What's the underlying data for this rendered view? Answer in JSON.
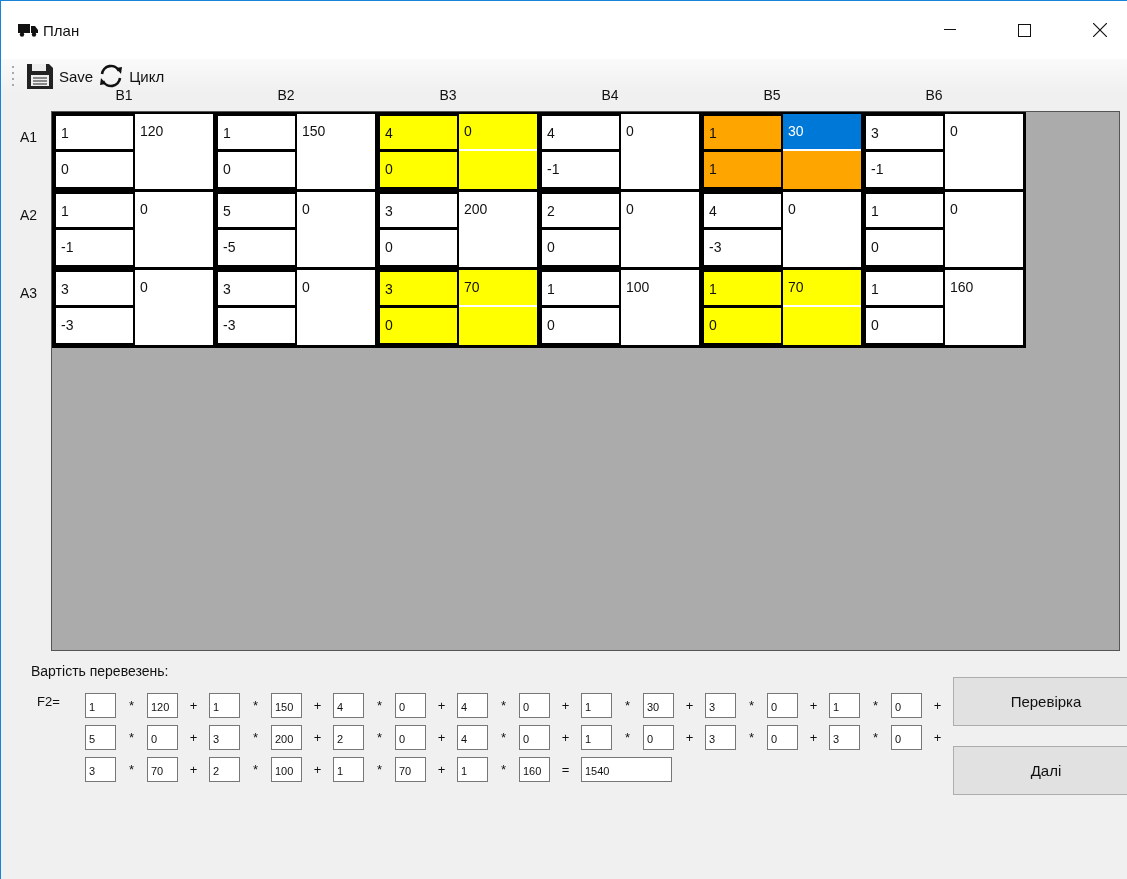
{
  "window": {
    "title": "План"
  },
  "toolbar": [
    {
      "kind": "save",
      "label": "Save"
    },
    {
      "kind": "cycle",
      "label": "Цикл"
    }
  ],
  "plan": {
    "columns": [
      "B1",
      "B2",
      "B3",
      "B4",
      "B5",
      "B6"
    ],
    "rows": [
      {
        "label": "A1",
        "cells": [
          {
            "cost": "1",
            "potential": "0",
            "amount": "120",
            "color": "#ffffff",
            "amount_selected": false
          },
          {
            "cost": "1",
            "potential": "0",
            "amount": "150",
            "color": "#ffffff",
            "amount_selected": false
          },
          {
            "cost": "4",
            "potential": "0",
            "amount": "0",
            "color": "#ffff00",
            "amount_selected": false
          },
          {
            "cost": "4",
            "potential": "-1",
            "amount": "0",
            "color": "#ffffff",
            "amount_selected": false
          },
          {
            "cost": "1",
            "potential": "1",
            "amount": "30",
            "color": "#ffa500",
            "amount_selected": true
          },
          {
            "cost": "3",
            "potential": "-1",
            "amount": "0",
            "color": "#ffffff",
            "amount_selected": false
          }
        ]
      },
      {
        "label": "A2",
        "cells": [
          {
            "cost": "1",
            "potential": "-1",
            "amount": "0",
            "color": "#ffffff",
            "amount_selected": false
          },
          {
            "cost": "5",
            "potential": "-5",
            "amount": "0",
            "color": "#ffffff",
            "amount_selected": false
          },
          {
            "cost": "3",
            "potential": "0",
            "amount": "200",
            "color": "#ffffff",
            "amount_selected": false
          },
          {
            "cost": "2",
            "potential": "0",
            "amount": "0",
            "color": "#ffffff",
            "amount_selected": false
          },
          {
            "cost": "4",
            "potential": "-3",
            "amount": "0",
            "color": "#ffffff",
            "amount_selected": false
          },
          {
            "cost": "1",
            "potential": "0",
            "amount": "0",
            "color": "#ffffff",
            "amount_selected": false
          }
        ]
      },
      {
        "label": "A3",
        "cells": [
          {
            "cost": "3",
            "potential": "-3",
            "amount": "0",
            "color": "#ffffff",
            "amount_selected": false
          },
          {
            "cost": "3",
            "potential": "-3",
            "amount": "0",
            "color": "#ffffff",
            "amount_selected": false
          },
          {
            "cost": "3",
            "potential": "0",
            "amount": "70",
            "color": "#ffff00",
            "amount_selected": false
          },
          {
            "cost": "1",
            "potential": "0",
            "amount": "100",
            "color": "#ffffff",
            "amount_selected": false
          },
          {
            "cost": "1",
            "potential": "0",
            "amount": "70",
            "color": "#ffff00",
            "amount_selected": false
          },
          {
            "cost": "1",
            "potential": "0",
            "amount": "160",
            "color": "#ffffff",
            "amount_selected": false
          }
        ]
      }
    ]
  },
  "cost_section": {
    "title": "Вартість перевезень:",
    "label": "F2=",
    "lines": [
      [
        {
          "kind": "field",
          "text": "1"
        },
        {
          "kind": "op",
          "text": "*"
        },
        {
          "kind": "field",
          "text": "120"
        },
        {
          "kind": "op",
          "text": "+"
        },
        {
          "kind": "field",
          "text": "1"
        },
        {
          "kind": "op",
          "text": "*"
        },
        {
          "kind": "field",
          "text": "150"
        },
        {
          "kind": "op",
          "text": "+"
        },
        {
          "kind": "field",
          "text": "4"
        },
        {
          "kind": "op",
          "text": "*"
        },
        {
          "kind": "field",
          "text": "0"
        },
        {
          "kind": "op",
          "text": "+"
        },
        {
          "kind": "field",
          "text": "4"
        },
        {
          "kind": "op",
          "text": "*"
        },
        {
          "kind": "field",
          "text": "0"
        },
        {
          "kind": "op",
          "text": "+"
        },
        {
          "kind": "field",
          "text": "1"
        },
        {
          "kind": "op",
          "text": "*"
        },
        {
          "kind": "field",
          "text": "30"
        },
        {
          "kind": "op",
          "text": "+"
        },
        {
          "kind": "field",
          "text": "3"
        },
        {
          "kind": "op",
          "text": "*"
        },
        {
          "kind": "field",
          "text": "0"
        },
        {
          "kind": "op",
          "text": "+"
        },
        {
          "kind": "field",
          "text": "1"
        },
        {
          "kind": "op",
          "text": "*"
        },
        {
          "kind": "field",
          "text": "0"
        },
        {
          "kind": "op",
          "text": "+"
        }
      ],
      [
        {
          "kind": "field",
          "text": "5"
        },
        {
          "kind": "op",
          "text": "*"
        },
        {
          "kind": "field",
          "text": "0"
        },
        {
          "kind": "op",
          "text": "+"
        },
        {
          "kind": "field",
          "text": "3"
        },
        {
          "kind": "op",
          "text": "*"
        },
        {
          "kind": "field",
          "text": "200"
        },
        {
          "kind": "op",
          "text": "+"
        },
        {
          "kind": "field",
          "text": "2"
        },
        {
          "kind": "op",
          "text": "*"
        },
        {
          "kind": "field",
          "text": "0"
        },
        {
          "kind": "op",
          "text": "+"
        },
        {
          "kind": "field",
          "text": "4"
        },
        {
          "kind": "op",
          "text": "*"
        },
        {
          "kind": "field",
          "text": "0"
        },
        {
          "kind": "op",
          "text": "+"
        },
        {
          "kind": "field",
          "text": "1"
        },
        {
          "kind": "op",
          "text": "*"
        },
        {
          "kind": "field",
          "text": "0"
        },
        {
          "kind": "op",
          "text": "+"
        },
        {
          "kind": "field",
          "text": "3"
        },
        {
          "kind": "op",
          "text": "*"
        },
        {
          "kind": "field",
          "text": "0"
        },
        {
          "kind": "op",
          "text": "+"
        },
        {
          "kind": "field",
          "text": "3"
        },
        {
          "kind": "op",
          "text": "*"
        },
        {
          "kind": "field",
          "text": "0"
        },
        {
          "kind": "op",
          "text": "+"
        }
      ],
      [
        {
          "kind": "field",
          "text": "3"
        },
        {
          "kind": "op",
          "text": "*"
        },
        {
          "kind": "field",
          "text": "70"
        },
        {
          "kind": "op",
          "text": "+"
        },
        {
          "kind": "field",
          "text": "2"
        },
        {
          "kind": "op",
          "text": "*"
        },
        {
          "kind": "field",
          "text": "100"
        },
        {
          "kind": "op",
          "text": "+"
        },
        {
          "kind": "field",
          "text": "1"
        },
        {
          "kind": "op",
          "text": "*"
        },
        {
          "kind": "field",
          "text": "70"
        },
        {
          "kind": "op",
          "text": "+"
        },
        {
          "kind": "field",
          "text": "1"
        },
        {
          "kind": "op",
          "text": "*"
        },
        {
          "kind": "field",
          "text": "160"
        },
        {
          "kind": "op",
          "text": "="
        },
        {
          "kind": "result",
          "text": "1540"
        }
      ]
    ]
  },
  "buttons": [
    {
      "label": "Перевірка"
    },
    {
      "label": "Далі"
    }
  ]
}
